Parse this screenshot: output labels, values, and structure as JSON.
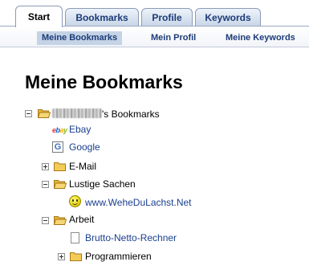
{
  "tabs": {
    "start": "Start",
    "bookmarks": "Bookmarks",
    "profile": "Profile",
    "keywords": "Keywords"
  },
  "subnav": {
    "meine_bookmarks": "Meine Bookmarks",
    "mein_profil": "Mein Profil",
    "meine_keywords": "Meine Keywords"
  },
  "page_title": "Meine Bookmarks",
  "tree": {
    "root_suffix": "'s Bookmarks",
    "ebay": "Ebay",
    "google": "Google",
    "email": "E-Mail",
    "lustige_sachen": "Lustige Sachen",
    "wehedulachst": "www.WeheDuLachst.Net",
    "arbeit": "Arbeit",
    "brutto_netto": "Brutto-Netto-Rechner",
    "programmieren": "Programmieren"
  },
  "icons": {
    "folder": "folder-icon",
    "folder_open": "folder-open-icon",
    "ebay": "ebay-icon",
    "google": "google-icon",
    "smiley": "smiley-icon",
    "page": "page-icon"
  },
  "colors": {
    "tab_text": "#1c3c78",
    "link": "#1a3f8f",
    "subnav_active_bg": "#c5d3e6",
    "folder": "#f2c14e"
  }
}
